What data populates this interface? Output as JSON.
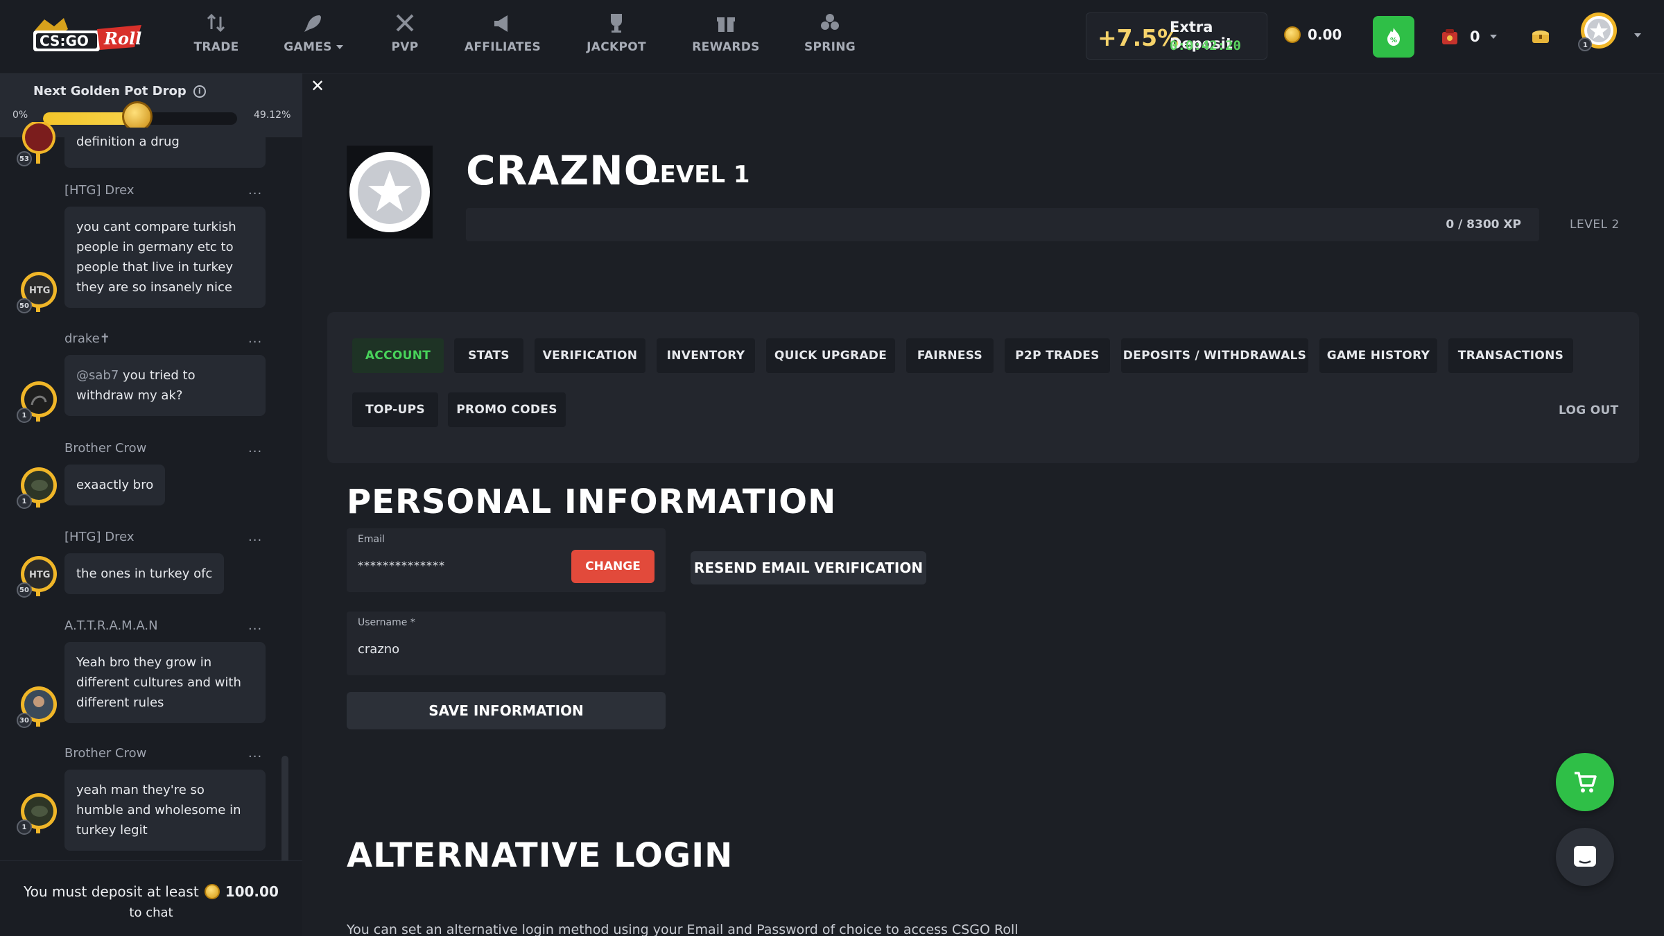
{
  "nav": {
    "items": [
      {
        "label": "TRADE",
        "icon": "trade-icon"
      },
      {
        "label": "GAMES",
        "icon": "rocket-icon",
        "dropdown": true
      },
      {
        "label": "PVP",
        "icon": "swords-icon"
      },
      {
        "label": "AFFILIATES",
        "icon": "megaphone-icon"
      },
      {
        "label": "JACKPOT",
        "icon": "trophy-icon"
      },
      {
        "label": "REWARDS",
        "icon": "gift-icon"
      },
      {
        "label": "SPRING",
        "icon": "flower-icon"
      }
    ]
  },
  "deposit": {
    "percent": "+7.5%",
    "title": "Extra Deposit",
    "timer": "0:0:42:20"
  },
  "balance": {
    "value": "0.00"
  },
  "cases": {
    "count": "0"
  },
  "golden_pot": {
    "title": "Next Golden Pot Drop",
    "min": "0%",
    "progress": "49.12%",
    "progress_value": 49.12
  },
  "chat": {
    "messages": [
      {
        "user": "",
        "level": "53",
        "text": "definition a drug"
      },
      {
        "user": "[HTG] Drex",
        "level": "50",
        "text": "you cant compare turkish people in germany etc to people that live in turkey they are so insanely nice"
      },
      {
        "user": "drake✝",
        "level": "1",
        "mention": "@sab7",
        "text": "you tried to withdraw my ak?"
      },
      {
        "user": "Brother Crow",
        "level": "1",
        "text": "exaactly bro"
      },
      {
        "user": "[HTG] Drex",
        "level": "50",
        "text": "the ones in turkey ofc"
      },
      {
        "user": "A.T.T.R.A.M.A.N",
        "level": "30",
        "text": "Yeah bro they grow in different cultures and with different rules"
      },
      {
        "user": "Brother Crow",
        "level": "1",
        "text": "yeah man they're so humble and wholesome in turkey legit"
      }
    ],
    "dots": "...",
    "footer_line1": "You must deposit at least",
    "footer_amount": "100.00",
    "footer_line2": "to chat"
  },
  "profile": {
    "name": "CRAZNO",
    "level": "LEVEL 1",
    "xp": "0 / 8300 XP",
    "next_level": "LEVEL 2",
    "xp_progress": 0
  },
  "tabs": [
    {
      "label": "ACCOUNT",
      "active": true
    },
    {
      "label": "STATS"
    },
    {
      "label": "VERIFICATION"
    },
    {
      "label": "INVENTORY"
    },
    {
      "label": "QUICK UPGRADE"
    },
    {
      "label": "FAIRNESS"
    },
    {
      "label": "P2P TRADES"
    },
    {
      "label": "DEPOSITS / WITHDRAWALS"
    },
    {
      "label": "GAME HISTORY"
    },
    {
      "label": "TRANSACTIONS"
    },
    {
      "label": "TOP-UPS"
    },
    {
      "label": "PROMO CODES"
    }
  ],
  "logout": "LOG OUT",
  "personal": {
    "title": "PERSONAL INFORMATION",
    "email_label": "Email",
    "email_value": "**************",
    "change": "CHANGE",
    "resend": "RESEND EMAIL VERIFICATION",
    "username_label": "Username *",
    "username_value": "crazno",
    "save": "SAVE INFORMATION"
  },
  "alt_login": {
    "title": "ALTERNATIVE LOGIN",
    "text": "You can set an alternative login method using your Email and Password of choice to access CSGO Roll"
  },
  "colors": {
    "accent_green": "#2fbf47",
    "gold": "#f6d36b",
    "danger": "#e24a3b",
    "bg": "#1c1f25"
  }
}
